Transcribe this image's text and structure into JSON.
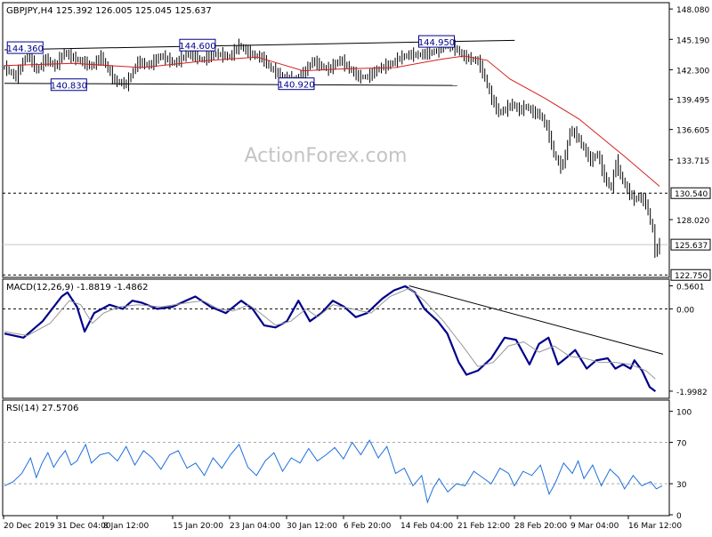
{
  "chart_data": [
    {
      "type": "candlestick",
      "title": "GBPJPY,H4  125.392 126.005 125.045 125.637",
      "watermark": "ActionForex.com",
      "ylim": [
        122.6,
        148.6
      ],
      "y_ticks": [
        "148.080",
        "145.190",
        "142.300",
        "139.495",
        "136.605",
        "133.715",
        "128.020"
      ],
      "x_categories": [
        "20 Dec 2019",
        "31 Dec 04:00",
        "8 Jan 12:00",
        "15 Jan 20:00",
        "23 Jan 04:00",
        "30 Jan 12:00",
        "6 Feb 20:00",
        "14 Feb 04:00",
        "21 Feb 12:00",
        "28 Feb 20:00",
        "9 Mar 04:00",
        "16 Mar 12:00"
      ],
      "price_path": [
        [
          0,
          142.5
        ],
        [
          5,
          141.6
        ],
        [
          10,
          143.9
        ],
        [
          14,
          142.2
        ],
        [
          18,
          143.3
        ],
        [
          22,
          142.6
        ],
        [
          26,
          143.9
        ],
        [
          30,
          143.4
        ],
        [
          34,
          143.0
        ],
        [
          38,
          142.6
        ],
        [
          42,
          143.5
        ],
        [
          48,
          141.2
        ],
        [
          53,
          140.9
        ],
        [
          58,
          143.0
        ],
        [
          63,
          142.7
        ],
        [
          68,
          143.6
        ],
        [
          74,
          142.9
        ],
        [
          80,
          143.8
        ],
        [
          86,
          143.2
        ],
        [
          92,
          143.8
        ],
        [
          98,
          143.5
        ],
        [
          102,
          144.6
        ],
        [
          107,
          143.8
        ],
        [
          112,
          143.4
        ],
        [
          116,
          142.4
        ],
        [
          121,
          141.6
        ],
        [
          126,
          141.3
        ],
        [
          130,
          141.9
        ],
        [
          134,
          143.1
        ],
        [
          137,
          142.7
        ],
        [
          141,
          142.3
        ],
        [
          146,
          143.2
        ],
        [
          150,
          142.4
        ],
        [
          154,
          141.6
        ],
        [
          158,
          141.6
        ],
        [
          163,
          142.4
        ],
        [
          168,
          142.8
        ],
        [
          172,
          143.4
        ],
        [
          176,
          143.7
        ],
        [
          180,
          143.7
        ],
        [
          184,
          143.8
        ],
        [
          188,
          144.1
        ],
        [
          191,
          144.6
        ],
        [
          194,
          144.5
        ],
        [
          197,
          144.2
        ],
        [
          200,
          143.5
        ],
        [
          203,
          143.3
        ],
        [
          206,
          143.1
        ],
        [
          209,
          141.5
        ],
        [
          212,
          139.5
        ],
        [
          215,
          138.2
        ],
        [
          218,
          138.5
        ],
        [
          221,
          139.0
        ],
        [
          224,
          138.4
        ],
        [
          227,
          138.8
        ],
        [
          230,
          138.2
        ],
        [
          233,
          138.0
        ],
        [
          236,
          136.8
        ],
        [
          239,
          134.3
        ],
        [
          242,
          133.0
        ],
        [
          244,
          134.0
        ],
        [
          246,
          136.5
        ],
        [
          249,
          136.0
        ],
        [
          252,
          134.8
        ],
        [
          255,
          133.6
        ],
        [
          258,
          134.3
        ],
        [
          261,
          132.0
        ],
        [
          264,
          131.0
        ],
        [
          266,
          133.5
        ],
        [
          268,
          132.2
        ],
        [
          271,
          130.8
        ],
        [
          274,
          129.9
        ],
        [
          276,
          130.2
        ],
        [
          279,
          129.6
        ],
        [
          282,
          127.0
        ],
        [
          283,
          124.9
        ],
        [
          285,
          125.637
        ]
      ],
      "candle_span": 285,
      "ma_path": [
        [
          0,
          142.7
        ],
        [
          30,
          142.9
        ],
        [
          60,
          142.5
        ],
        [
          90,
          143.2
        ],
        [
          110,
          143.5
        ],
        [
          130,
          142.2
        ],
        [
          150,
          142.4
        ],
        [
          170,
          142.5
        ],
        [
          190,
          143.3
        ],
        [
          200,
          143.6
        ],
        [
          210,
          143.2
        ],
        [
          220,
          141.4
        ],
        [
          235,
          139.6
        ],
        [
          250,
          137.6
        ],
        [
          260,
          135.8
        ],
        [
          270,
          134.0
        ],
        [
          285,
          131.2
        ]
      ],
      "support_lines": [
        {
          "label": "130.540",
          "value": 130.54
        },
        {
          "label": "122.750",
          "value": 122.75
        }
      ],
      "current_level": {
        "label": "125.637",
        "value": 125.637
      },
      "swing_labels": [
        {
          "label": "144.360",
          "value": 144.36,
          "bar": 9
        },
        {
          "label": "140.830",
          "value": 140.83,
          "bar": 28
        },
        {
          "label": "144.600",
          "value": 144.6,
          "bar": 84
        },
        {
          "label": "140.920",
          "value": 140.92,
          "bar": 127
        },
        {
          "label": "144.950",
          "value": 144.95,
          "bar": 188
        }
      ],
      "channel_upper": [
        [
          0,
          144.2
        ],
        [
          222,
          145.1
        ]
      ],
      "channel_lower": [
        [
          0,
          141.0
        ],
        [
          197,
          140.8
        ]
      ]
    },
    {
      "type": "line",
      "title": "MACD(12,26,9) -1.8819 -1.4862",
      "ylim": [
        -2.15,
        0.7
      ],
      "y_ticks": [
        "0.5601",
        "0.00",
        "-1.9982"
      ],
      "series": [
        {
          "role": "macd",
          "color": "#00008b",
          "points": [
            [
              0,
              -0.6
            ],
            [
              10,
              -0.7
            ],
            [
              20,
              -0.3
            ],
            [
              30,
              0.3
            ],
            [
              33,
              0.4
            ],
            [
              38,
              0.05
            ],
            [
              42,
              -0.55
            ],
            [
              47,
              -0.1
            ],
            [
              55,
              0.1
            ],
            [
              62,
              0.0
            ],
            [
              67,
              0.2
            ],
            [
              72,
              0.15
            ],
            [
              80,
              0.0
            ],
            [
              88,
              0.05
            ],
            [
              95,
              0.2
            ],
            [
              100,
              0.3
            ],
            [
              108,
              0.05
            ],
            [
              116,
              -0.1
            ],
            [
              124,
              0.2
            ],
            [
              130,
              0.0
            ],
            [
              136,
              -0.4
            ],
            [
              142,
              -0.45
            ],
            [
              148,
              -0.3
            ],
            [
              154,
              0.2
            ],
            [
              160,
              -0.3
            ],
            [
              166,
              -0.1
            ],
            [
              172,
              0.2
            ],
            [
              178,
              0.05
            ],
            [
              184,
              -0.2
            ],
            [
              190,
              -0.1
            ],
            [
              198,
              0.25
            ],
            [
              204,
              0.45
            ],
            [
              210,
              0.55
            ],
            [
              215,
              0.4
            ],
            [
              220,
              0.0
            ],
            [
              227,
              -0.3
            ],
            [
              232,
              -0.6
            ],
            [
              238,
              -1.3
            ],
            [
              242,
              -1.6
            ],
            [
              248,
              -1.5
            ],
            [
              255,
              -1.2
            ],
            [
              262,
              -0.7
            ],
            [
              268,
              -0.75
            ],
            [
              275,
              -1.35
            ],
            [
              280,
              -0.85
            ],
            [
              285,
              -0.7
            ],
            [
              290,
              -1.35
            ],
            [
              294,
              -1.2
            ],
            [
              299,
              -1.0
            ],
            [
              305,
              -1.45
            ],
            [
              310,
              -1.25
            ],
            [
              316,
              -1.2
            ],
            [
              320,
              -1.45
            ],
            [
              324,
              -1.35
            ],
            [
              328,
              -1.45
            ],
            [
              330,
              -1.25
            ],
            [
              334,
              -1.5
            ],
            [
              338,
              -1.9
            ],
            [
              341,
              -2.0
            ]
          ]
        },
        {
          "role": "signal",
          "color": "#999999",
          "points": [
            [
              0,
              -0.55
            ],
            [
              12,
              -0.65
            ],
            [
              24,
              -0.35
            ],
            [
              34,
              0.2
            ],
            [
              40,
              0.1
            ],
            [
              46,
              -0.35
            ],
            [
              52,
              -0.1
            ],
            [
              60,
              0.05
            ],
            [
              70,
              0.1
            ],
            [
              82,
              0.05
            ],
            [
              96,
              0.15
            ],
            [
              104,
              0.2
            ],
            [
              112,
              0.0
            ],
            [
              120,
              -0.05
            ],
            [
              128,
              0.1
            ],
            [
              134,
              -0.1
            ],
            [
              142,
              -0.4
            ],
            [
              150,
              -0.3
            ],
            [
              158,
              0.0
            ],
            [
              164,
              -0.2
            ],
            [
              172,
              0.1
            ],
            [
              182,
              0.0
            ],
            [
              192,
              -0.1
            ],
            [
              202,
              0.3
            ],
            [
              212,
              0.5
            ],
            [
              220,
              0.2
            ],
            [
              230,
              -0.3
            ],
            [
              240,
              -0.9
            ],
            [
              248,
              -1.4
            ],
            [
              256,
              -1.3
            ],
            [
              264,
              -0.9
            ],
            [
              272,
              -0.8
            ],
            [
              280,
              -1.05
            ],
            [
              288,
              -0.9
            ],
            [
              296,
              -1.15
            ],
            [
              304,
              -1.2
            ],
            [
              312,
              -1.3
            ],
            [
              320,
              -1.3
            ],
            [
              328,
              -1.35
            ],
            [
              336,
              -1.5
            ],
            [
              341,
              -1.7
            ]
          ]
        }
      ],
      "trend_line": [
        [
          212,
          0.56
        ],
        [
          345,
          -1.1
        ]
      ]
    },
    {
      "type": "line",
      "title": "RSI(14) 27.5706",
      "ylim": [
        0,
        110
      ],
      "y_ticks": [
        "100",
        "70",
        "30",
        "0"
      ],
      "dashed_levels": [
        30,
        70
      ],
      "series": [
        {
          "role": "rsi",
          "color": "#1e6fdc",
          "points": [
            [
              0,
              28
            ],
            [
              6,
              32
            ],
            [
              12,
              40
            ],
            [
              18,
              55
            ],
            [
              22,
              36
            ],
            [
              26,
              50
            ],
            [
              30,
              60
            ],
            [
              34,
              46
            ],
            [
              38,
              55
            ],
            [
              42,
              62
            ],
            [
              46,
              48
            ],
            [
              50,
              52
            ],
            [
              56,
              68
            ],
            [
              60,
              50
            ],
            [
              66,
              58
            ],
            [
              72,
              60
            ],
            [
              78,
              52
            ],
            [
              84,
              66
            ],
            [
              90,
              48
            ],
            [
              96,
              62
            ],
            [
              102,
              55
            ],
            [
              108,
              44
            ],
            [
              114,
              58
            ],
            [
              120,
              62
            ],
            [
              126,
              45
            ],
            [
              132,
              50
            ],
            [
              138,
              38
            ],
            [
              144,
              55
            ],
            [
              150,
              45
            ],
            [
              156,
              58
            ],
            [
              162,
              68
            ],
            [
              168,
              46
            ],
            [
              174,
              38
            ],
            [
              180,
              52
            ],
            [
              186,
              60
            ],
            [
              192,
              42
            ],
            [
              198,
              55
            ],
            [
              204,
              50
            ],
            [
              210,
              64
            ],
            [
              216,
              52
            ],
            [
              222,
              58
            ],
            [
              228,
              65
            ],
            [
              234,
              54
            ],
            [
              240,
              70
            ],
            [
              246,
              58
            ],
            [
              252,
              72
            ],
            [
              258,
              55
            ],
            [
              264,
              66
            ],
            [
              270,
              40
            ],
            [
              276,
              45
            ],
            [
              282,
              28
            ],
            [
              288,
              38
            ],
            [
              292,
              12
            ],
            [
              296,
              26
            ],
            [
              300,
              35
            ],
            [
              306,
              22
            ],
            [
              312,
              30
            ],
            [
              318,
              28
            ],
            [
              324,
              42
            ],
            [
              330,
              36
            ],
            [
              336,
              30
            ],
            [
              342,
              45
            ],
            [
              348,
              40
            ],
            [
              352,
              28
            ],
            [
              358,
              42
            ],
            [
              364,
              38
            ],
            [
              370,
              48
            ],
            [
              376,
              20
            ],
            [
              380,
              30
            ],
            [
              386,
              50
            ],
            [
              392,
              40
            ],
            [
              396,
              52
            ],
            [
              400,
              35
            ],
            [
              406,
              48
            ],
            [
              412,
              28
            ],
            [
              418,
              44
            ],
            [
              424,
              36
            ],
            [
              428,
              25
            ],
            [
              434,
              38
            ],
            [
              440,
              28
            ],
            [
              446,
              32
            ],
            [
              450,
              25
            ],
            [
              454,
              28
            ]
          ]
        }
      ]
    }
  ]
}
